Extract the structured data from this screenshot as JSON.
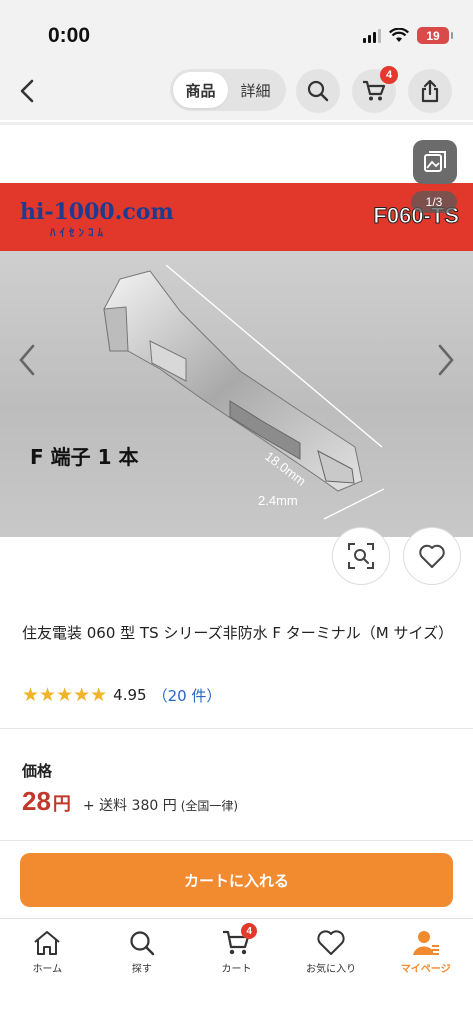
{
  "status_bar": {
    "time": "0:00",
    "battery": "19"
  },
  "nav": {
    "tabs": [
      {
        "label": "商品",
        "active": true
      },
      {
        "label": "詳細",
        "active": false
      }
    ],
    "cart_badge": "4"
  },
  "product_image": {
    "brand": "hi-1000.com",
    "brand_sub": "ﾊｲｾﾝｺﾑ",
    "code": "F060-TS",
    "page_counter": "1/3",
    "terminal_label": "F 端子 1 本",
    "dimension_length": "18.0mm",
    "dimension_width": "2.4mm"
  },
  "product": {
    "title": "住友電装 060 型 TS シリーズ非防水 F ターミナル（M サイズ）",
    "stars": "★★★★★",
    "rating": "4.95",
    "review_count": "（20 件）",
    "price_label": "価格",
    "price": "28",
    "price_unit": "円",
    "shipping": "+ 送料 380 円",
    "shipping_note": "(全国一律)"
  },
  "cart_button": "カートに入れる",
  "tab_bar": {
    "items": [
      {
        "label": "ホーム",
        "icon": "home-icon"
      },
      {
        "label": "探す",
        "icon": "search-icon"
      },
      {
        "label": "カート",
        "icon": "cart-icon"
      },
      {
        "label": "お気に入り",
        "icon": "heart-icon"
      },
      {
        "label": "マイページ",
        "icon": "user-icon"
      }
    ],
    "cart_badge": "4",
    "active_color": "#f28a2f"
  },
  "colors": {
    "accent": "#f28a2f",
    "price": "#c0392b",
    "banner": "#e2382b",
    "link": "#2867c5"
  }
}
